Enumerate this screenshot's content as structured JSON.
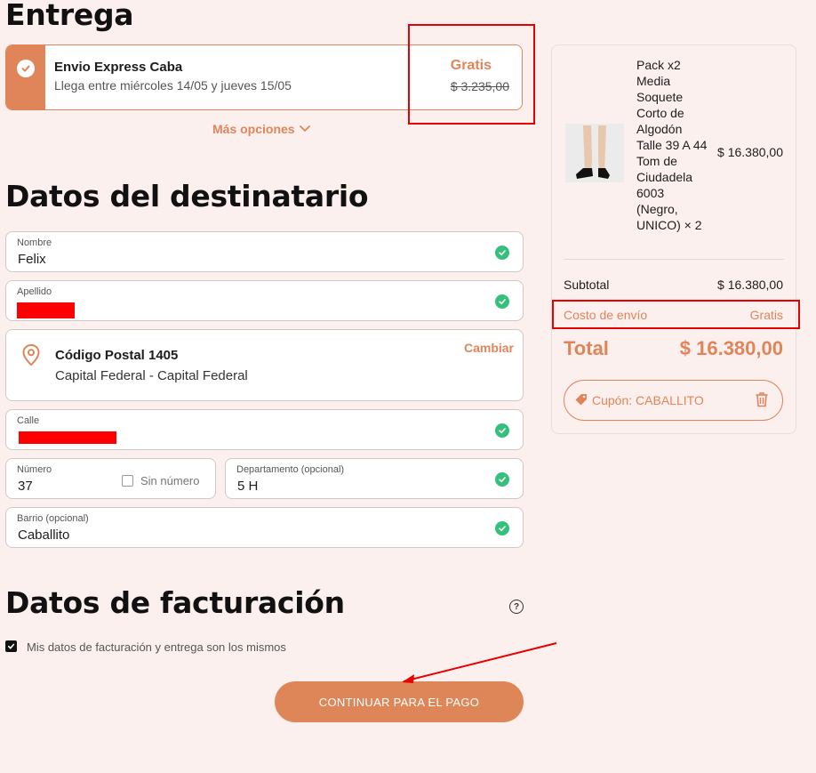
{
  "delivery": {
    "heading": "Entrega",
    "option_name": "Envio Express Caba",
    "option_eta": "Llega entre miércoles 14/05 y jueves 15/05",
    "option_price": "Gratis",
    "option_old_price": "$ 3.235,00",
    "more_options": "Más opciones"
  },
  "recipient": {
    "heading": "Datos del destinatario",
    "nombre_label": "Nombre",
    "nombre_value": "Felix",
    "apellido_label": "Apellido",
    "postal_title": "Código Postal 1405",
    "postal_sub": "Capital Federal - Capital Federal",
    "postal_change": "Cambiar",
    "calle_label": "Calle",
    "numero_label": "Número",
    "numero_value": "37",
    "sin_numero": "Sin número",
    "depto_label": "Departamento (opcional)",
    "depto_value": "5 H",
    "barrio_label": "Barrio (opcional)",
    "barrio_value": "Caballito"
  },
  "billing": {
    "heading": "Datos de facturación",
    "help": "?",
    "same_label": "Mis datos de facturación y entrega son los mismos",
    "same_checked": true
  },
  "cta": {
    "label": "CONTINUAR PARA EL PAGO"
  },
  "summary": {
    "product_name": "Pack x2 Media Soquete Corto de Algodón Talle 39 A 44 Tom de Ciudadela 6003 (Negro, UNICO) × 2",
    "product_price": "$ 16.380,00",
    "subtotal_label": "Subtotal",
    "subtotal_value": "$ 16.380,00",
    "shipping_label": "Costo de envío",
    "shipping_value": "Gratis",
    "total_label": "Total",
    "total_value": "$ 16.380,00",
    "coupon_label": "Cupón: CABALLITO"
  },
  "colors": {
    "accent": "#e0855a",
    "background": "#fcf0ee",
    "success": "#34c07a",
    "annotation_red": "#e60000"
  },
  "icons": [
    "check-icon",
    "chevron-down-icon",
    "location-pin-icon",
    "tag-icon",
    "trash-icon",
    "help-icon"
  ]
}
